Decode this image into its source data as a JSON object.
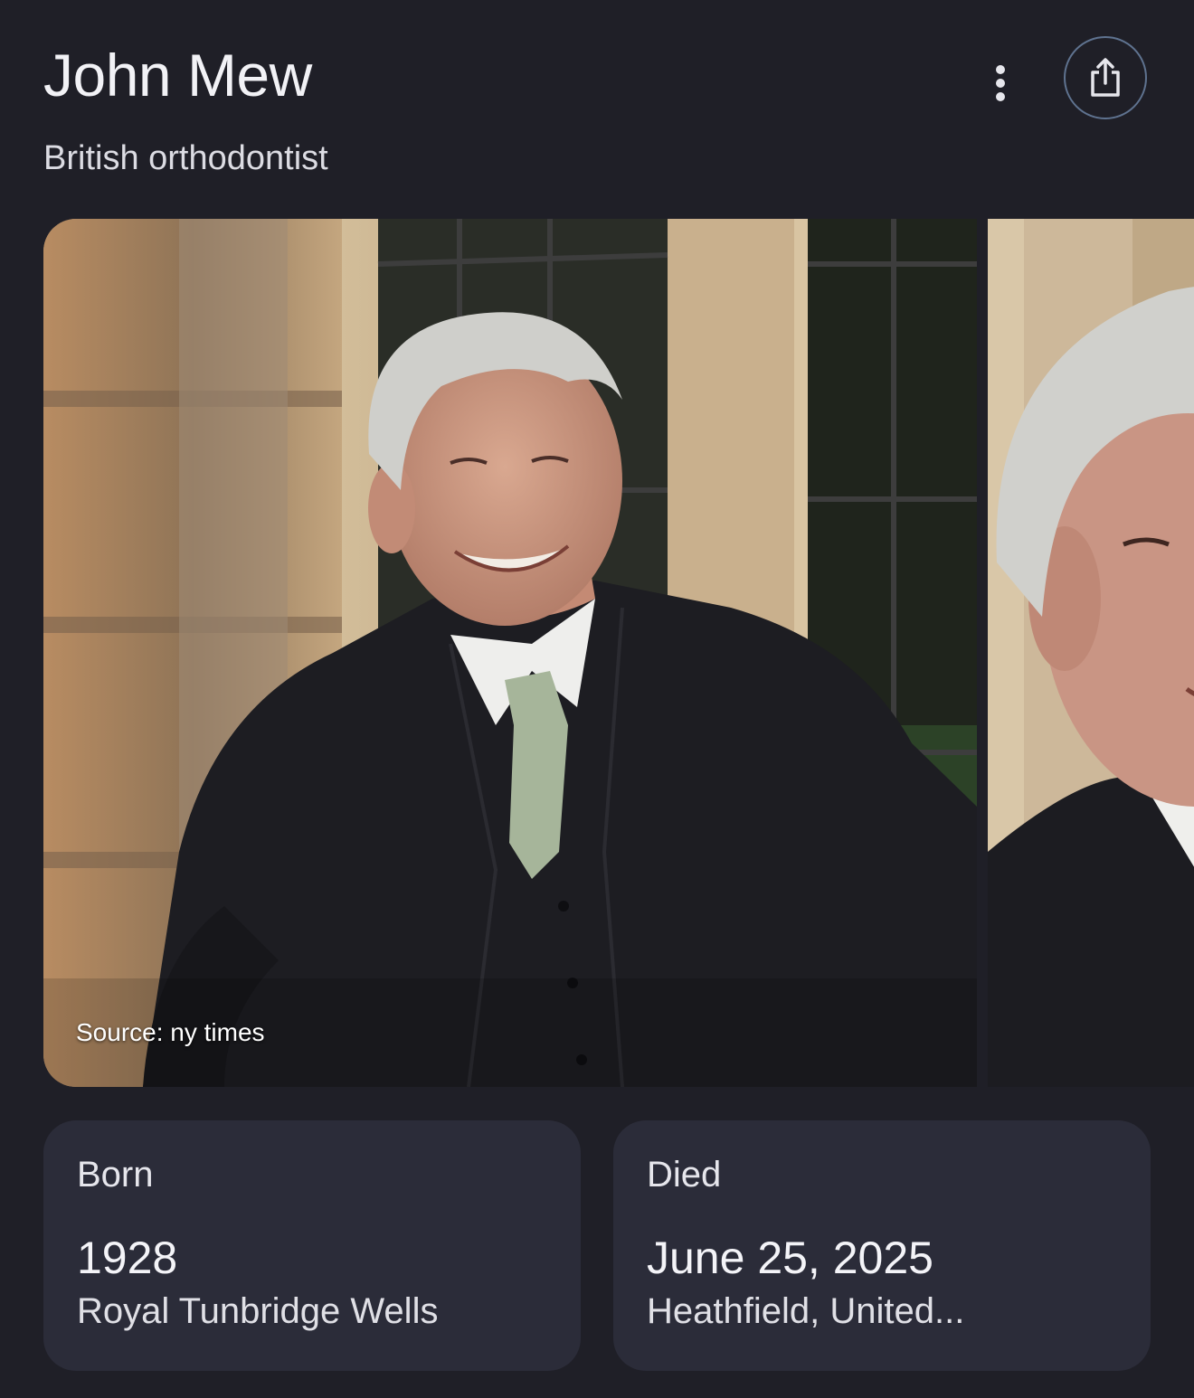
{
  "header": {
    "title": "John Mew",
    "subtitle": "British orthodontist",
    "more_icon": "more-vert-icon",
    "share_icon": "share-icon"
  },
  "images": {
    "source_label": "Source: ny times"
  },
  "facts": {
    "born": {
      "label": "Born",
      "value": "1928",
      "detail": "Royal Tunbridge Wells"
    },
    "died": {
      "label": "Died",
      "value": "June 25, 2025",
      "detail": "Heathfield, United..."
    }
  },
  "colors": {
    "background": "#1f1f27",
    "card": "#2b2c39",
    "share_ring": "#5f7390"
  }
}
